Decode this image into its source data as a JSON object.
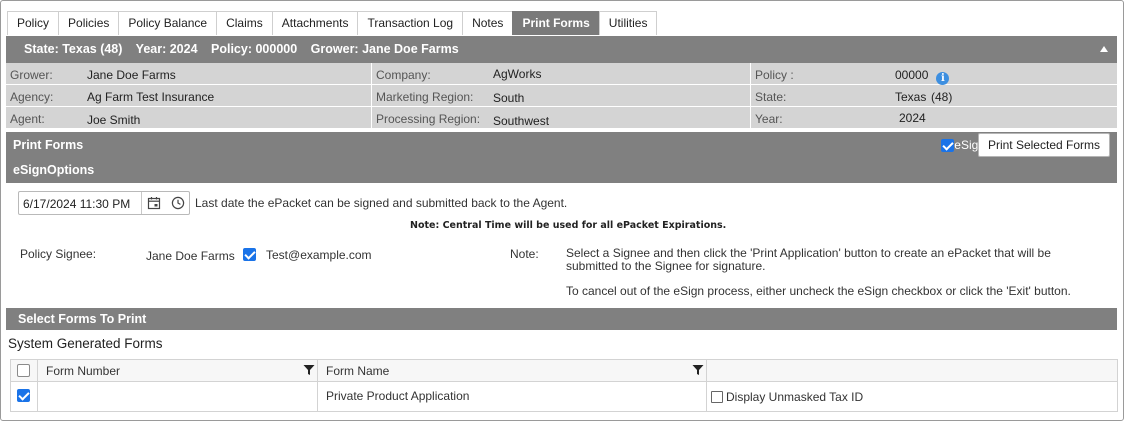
{
  "tabs": [
    {
      "label": "Policy",
      "active": false
    },
    {
      "label": "Policies",
      "active": false
    },
    {
      "label": "Policy Balance",
      "active": false
    },
    {
      "label": "Claims",
      "active": false
    },
    {
      "label": "Attachments",
      "active": false
    },
    {
      "label": "Transaction Log",
      "active": false
    },
    {
      "label": "Notes",
      "active": false
    },
    {
      "label": "Print Forms",
      "active": true
    },
    {
      "label": "Utilities",
      "active": false
    }
  ],
  "policy_bar": {
    "state": "State: Texas (48)",
    "year": "Year: 2024",
    "policy": "Policy: 000000",
    "grower": "Grower: Jane Doe Farms"
  },
  "info": {
    "grower_label": "Grower:",
    "grower_value": "Jane Doe Farms",
    "company_label": "Company:",
    "company_value": "AgWorks",
    "policy_label": "Policy :",
    "policy_value": "00000",
    "agency_label": "Agency:",
    "agency_value": "Ag Farm Test Insurance",
    "marketing_label": "Marketing Region:",
    "marketing_value": "South",
    "state_label": "State:",
    "state_value": "Texas",
    "state_code": "(48)",
    "agent_label": "Agent:",
    "agent_value": "Joe Smith",
    "processing_label": "Processing Region:",
    "processing_value": "Southwest",
    "year_label": "Year:",
    "year_value": "2024"
  },
  "print_forms": {
    "title": "Print Forms",
    "esign_label": "eSign",
    "esign_checked": true,
    "print_selected_label": "Print Selected Forms"
  },
  "esign_options": {
    "title": "eSignOptions",
    "expiration_value": "6/17/2024 11:30 PM",
    "expiration_desc": "Last date the ePacket can be signed and submitted back to the Agent.",
    "central_note": "Note: Central Time will be used for all ePacket Expirations.",
    "signee_label": "Policy Signee:",
    "signee_name": "Jane Doe Farms",
    "signee_checked": true,
    "signee_email": "Test@example.com",
    "note_label": "Note:",
    "note_line1": "Select a Signee and then click the 'Print Application' button to create an ePacket that will be submitted to the Signee for signature.",
    "note_line2": "To cancel out of the eSign process, either uncheck the eSign checkbox or click the 'Exit' button."
  },
  "select_forms": {
    "title": "Select Forms To Print",
    "system_generated_title": "System Generated Forms",
    "columns": {
      "form_number": "Form Number",
      "form_name": "Form Name"
    },
    "rows": [
      {
        "checked": true,
        "form_number": "",
        "form_name": "Private Product Application",
        "unmask_label": "Display Unmasked Tax ID",
        "unmask_checked": false
      }
    ]
  },
  "colors": {
    "bar_gray": "#808080",
    "info_gray": "#d4d4d4",
    "check_blue": "#1a73e8",
    "info_icon_blue": "#3d8fe0"
  }
}
